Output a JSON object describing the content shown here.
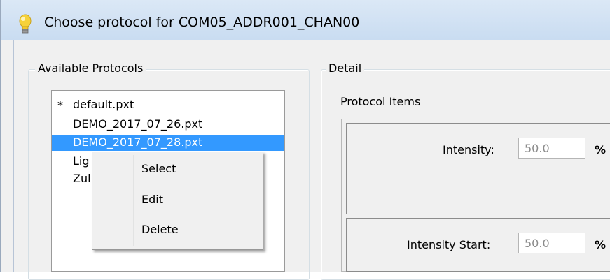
{
  "window": {
    "title": "Choose protocol for COM05_ADDR001_CHAN00",
    "icon": "lightbulb-icon"
  },
  "available_protocols": {
    "label": "Available Protocols",
    "items": [
      {
        "marker": "*",
        "name": "default.pxt",
        "selected": false
      },
      {
        "marker": "",
        "name": "DEMO_2017_07_26.pxt",
        "selected": false
      },
      {
        "marker": "",
        "name": "DEMO_2017_07_28.pxt",
        "selected": true
      },
      {
        "marker": "",
        "name": "Lig",
        "selected": false
      },
      {
        "marker": "",
        "name": "Zul",
        "selected": false
      }
    ]
  },
  "context_menu": {
    "items": [
      "Select",
      "Edit",
      "Delete"
    ]
  },
  "detail": {
    "label": "Detail",
    "protocol_items_label": "Protocol Items",
    "fields": [
      {
        "label": "Intensity:",
        "value": "50.0",
        "unit": "%"
      },
      {
        "label": "Intensity Start:",
        "value": "50.0",
        "unit": "%"
      }
    ]
  }
}
